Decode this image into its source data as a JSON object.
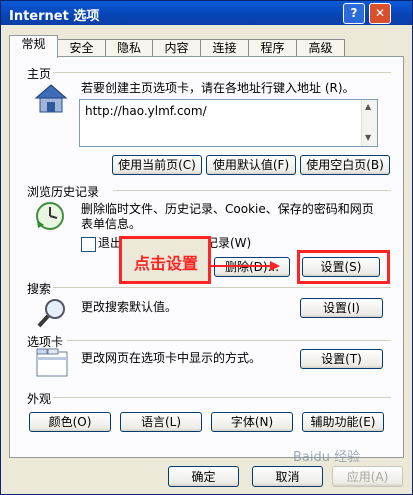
{
  "window": {
    "title": "Internet 选项",
    "help_glyph": "?",
    "close_glyph": "✕"
  },
  "tabs": [
    "常规",
    "安全",
    "隐私",
    "内容",
    "连接",
    "程序",
    "高级"
  ],
  "home": {
    "label": "主页",
    "desc": "若要创建主页选项卡，请在各地址行键入地址 (R)。",
    "url": "http://hao.ylmf.com/",
    "buttons": [
      "使用当前页(C)",
      "使用默认值(F)",
      "使用空白页(B)"
    ]
  },
  "history": {
    "label": "浏览历史记录",
    "desc": "删除临时文件、历史记录、Cookie、保存的密码和网页表单信息。",
    "checkbox_label": "退出时删除浏览历史记录(W)",
    "delete_button": "删除(D)...",
    "settings_button": "设置(S)",
    "annotation": "点击设置"
  },
  "search": {
    "label": "搜索",
    "desc": "更改搜索默认值。",
    "settings_button": "设置(I)"
  },
  "tabs_section": {
    "label": "选项卡",
    "desc": "更改网页在选项卡中显示的方式。",
    "settings_button": "设置(T)"
  },
  "appearance": {
    "label": "外观",
    "buttons": [
      "颜色(O)",
      "语言(L)",
      "字体(N)",
      "辅助功能(E)"
    ]
  },
  "footer": {
    "ok": "确定",
    "cancel": "取消",
    "apply": "应用(A)"
  },
  "watermark": "Baidu 经验",
  "colors": {
    "annotation_red": "#ff2424",
    "titlebar_blue": "#0a5ad8"
  }
}
